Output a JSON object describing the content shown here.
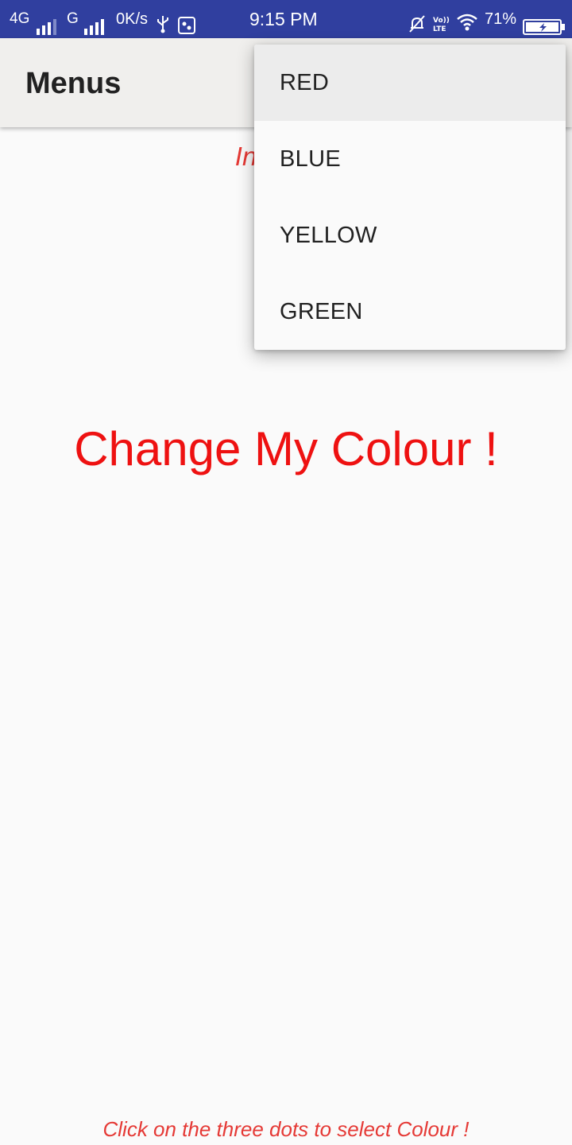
{
  "status_bar": {
    "network_primary": "4G",
    "network_secondary": "G",
    "data_speed": "0K/s",
    "time": "9:15 PM",
    "battery_percent": "71%",
    "icons": [
      "signal-icon",
      "usb-icon",
      "app-notification-icon",
      "mute-icon",
      "volte-icon",
      "wifi-icon",
      "battery-charging-icon"
    ]
  },
  "app_bar": {
    "title": "Menus"
  },
  "content": {
    "intro_text": "Introduct",
    "main_text": "Change My Colour !",
    "footer_hint": "Click on the three dots to select Colour !"
  },
  "popup_menu": {
    "items": [
      {
        "label": "RED"
      },
      {
        "label": "BLUE"
      },
      {
        "label": "YELLOW"
      },
      {
        "label": "GREEN"
      }
    ]
  },
  "colors": {
    "status_bar": "#303f9f",
    "app_bar": "#f0efed",
    "accent_text": "#ee1111",
    "italic_text": "#e53935",
    "background": "#fafafa"
  }
}
